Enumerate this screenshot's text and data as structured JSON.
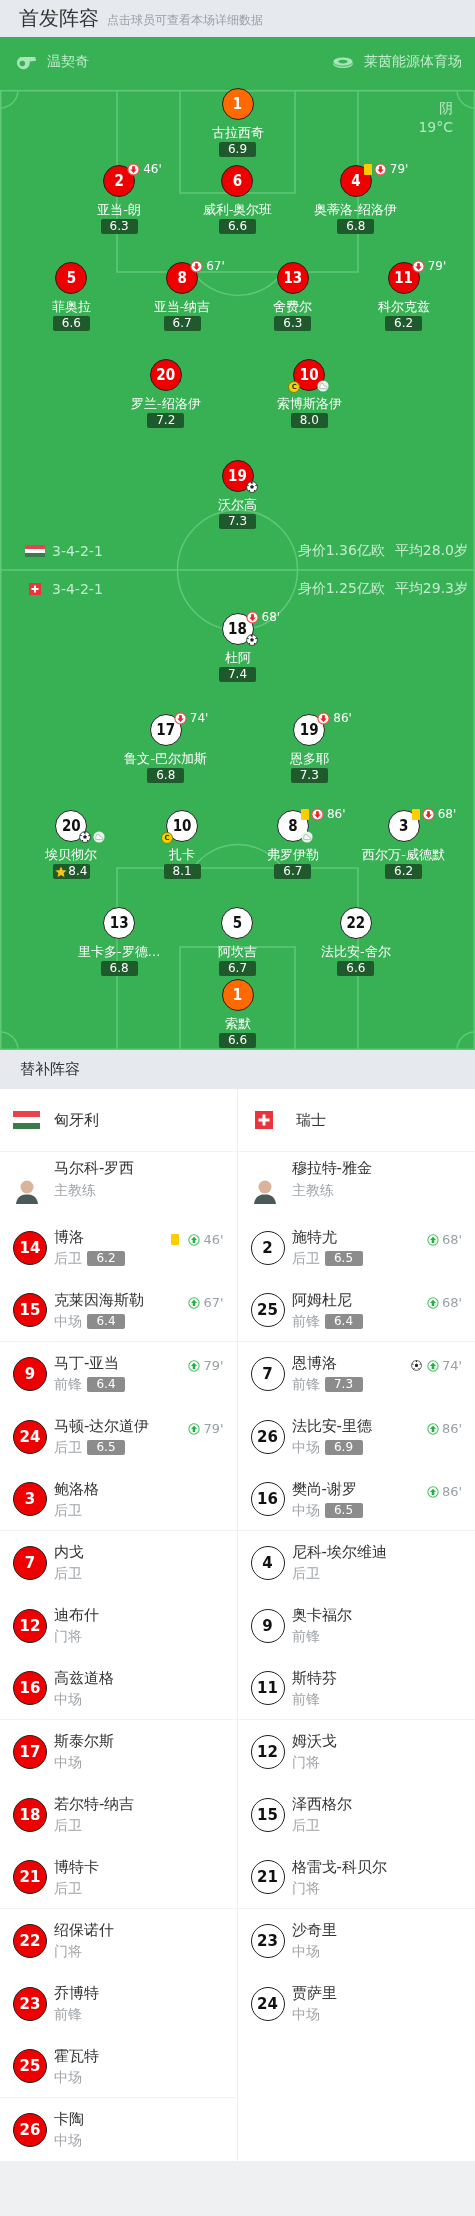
{
  "header": {
    "title": "首发阵容",
    "subtitle": "点击球员可查看本场详细数据"
  },
  "match_info": {
    "referee": "温契奇",
    "stadium": "莱茵能源体育场",
    "weather": "阴",
    "temperature": "19°C"
  },
  "lineups": [
    {
      "kind": "home",
      "formation": "3-4-2-1",
      "value": "身价1.36亿欧",
      "avg_age": "平均28.0岁",
      "lines": [
        {
          "kind": "goalkeeper",
          "players": [
            {
              "number": "1",
              "name": "古拉西奇",
              "rating": "6.9"
            }
          ]
        },
        {
          "kind": "outfield",
          "players": [
            {
              "number": "2",
              "name": "亚当-朗",
              "rating": "6.3",
              "marks": [
                {
                  "kind": "sub",
                  "text": "46'"
                }
              ]
            },
            {
              "number": "6",
              "name": "威利-奥尔班",
              "rating": "6.6"
            },
            {
              "number": "4",
              "name": "奥蒂洛-绍洛伊",
              "rating": "6.8",
              "marks": [
                {
                  "kind": "yellow"
                },
                {
                  "kind": "sub",
                  "text": "79'"
                }
              ]
            }
          ]
        },
        {
          "kind": "outfield",
          "players": [
            {
              "number": "5",
              "name": "菲奥拉",
              "rating": "6.6"
            },
            {
              "number": "8",
              "name": "亚当-纳吉",
              "rating": "6.7",
              "marks": [
                {
                  "kind": "sub",
                  "text": "67'"
                }
              ]
            },
            {
              "number": "13",
              "name": "舍费尔",
              "rating": "6.3"
            },
            {
              "number": "11",
              "name": "科尔克兹",
              "rating": "6.2",
              "marks": [
                {
                  "kind": "sub",
                  "text": "79'"
                }
              ]
            }
          ]
        },
        {
          "kind": "outfield",
          "players": [
            {
              "number": "20",
              "name": "罗兰-绍洛伊",
              "rating": "7.2"
            },
            {
              "number": "10",
              "name": "索博斯洛伊",
              "rating": "8.0",
              "marks": [
                {
                  "kind": "captain",
                  "text": "C"
                },
                {
                  "kind": "assist"
                }
              ]
            }
          ]
        },
        {
          "kind": "outfield",
          "players": [
            {
              "number": "19",
              "name": "沃尔高",
              "rating": "7.3",
              "marks": [
                {
                  "kind": "goal"
                }
              ]
            }
          ]
        }
      ]
    },
    {
      "kind": "away",
      "formation": "3-4-2-1",
      "value": "身价1.25亿欧",
      "avg_age": "平均29.3岁",
      "lines": [
        {
          "kind": "outfield",
          "players": [
            {
              "number": "18",
              "name": "杜阿",
              "rating": "7.4",
              "marks": [
                {
                  "kind": "sub",
                  "text": "68'"
                },
                {
                  "kind": "goal"
                }
              ]
            }
          ]
        },
        {
          "kind": "outfield",
          "players": [
            {
              "number": "17",
              "name": "鲁文-巴尔加斯",
              "rating": "6.8",
              "marks": [
                {
                  "kind": "sub",
                  "text": "74'"
                }
              ]
            },
            {
              "number": "19",
              "name": "恩多耶",
              "rating": "7.3",
              "marks": [
                {
                  "kind": "sub",
                  "text": "86'"
                }
              ]
            }
          ]
        },
        {
          "kind": "outfield",
          "players": [
            {
              "number": "20",
              "name": "埃贝彻尔",
              "rating": "8.4",
              "marks": [
                {
                  "kind": "goal"
                },
                {
                  "kind": "assist"
                },
                {
                  "kind": "motm"
                }
              ]
            },
            {
              "number": "10",
              "name": "扎卡",
              "rating": "8.1",
              "marks": [
                {
                  "kind": "captain",
                  "text": "C"
                }
              ]
            },
            {
              "number": "8",
              "name": "弗罗伊勒",
              "rating": "6.7",
              "marks": [
                {
                  "kind": "yellow"
                },
                {
                  "kind": "sub",
                  "text": "86'"
                },
                {
                  "kind": "assist"
                }
              ]
            },
            {
              "number": "3",
              "name": "西尔万-威德默",
              "rating": "6.2",
              "marks": [
                {
                  "kind": "yellow"
                },
                {
                  "kind": "sub",
                  "text": "68'"
                }
              ]
            }
          ]
        },
        {
          "kind": "outfield",
          "players": [
            {
              "number": "13",
              "name": "里卡多-罗德…",
              "rating": "6.8"
            },
            {
              "number": "5",
              "name": "阿坎吉",
              "rating": "6.7"
            },
            {
              "number": "22",
              "name": "法比安-舍尔",
              "rating": "6.6"
            }
          ]
        },
        {
          "kind": "goalkeeper",
          "players": [
            {
              "number": "1",
              "name": "索默",
              "rating": "6.6"
            }
          ]
        }
      ]
    }
  ],
  "bench": {
    "title": "替补阵容",
    "teams": [
      {
        "kind": "home",
        "name": "匈牙利",
        "coach": {
          "name": "马尔科-罗西",
          "role": "主教练"
        },
        "players": [
          {
            "number": "14",
            "name": "博洛",
            "position": "后卫",
            "rating": "6.2",
            "marks": [
              {
                "kind": "yellow"
              },
              {
                "kind": "sub",
                "text": "46'"
              }
            ]
          },
          {
            "number": "15",
            "name": "克莱因海斯勒",
            "position": "中场",
            "rating": "6.4",
            "marks": [
              {
                "kind": "sub",
                "text": "67'"
              }
            ]
          },
          {
            "number": "9",
            "name": "马丁-亚当",
            "position": "前锋",
            "rating": "6.4",
            "marks": [
              {
                "kind": "sub",
                "text": "79'"
              }
            ]
          },
          {
            "number": "24",
            "name": "马顿-达尔道伊",
            "position": "后卫",
            "rating": "6.5",
            "marks": [
              {
                "kind": "sub",
                "text": "79'"
              }
            ]
          },
          {
            "number": "3",
            "name": "鲍洛格",
            "position": "后卫"
          },
          {
            "number": "7",
            "name": "内戈",
            "position": "后卫"
          },
          {
            "number": "12",
            "name": "迪布什",
            "position": "门将"
          },
          {
            "number": "16",
            "name": "高兹道格",
            "position": "中场"
          },
          {
            "number": "17",
            "name": "斯泰尔斯",
            "position": "中场"
          },
          {
            "number": "18",
            "name": "若尔特-纳吉",
            "position": "后卫"
          },
          {
            "number": "21",
            "name": "博特卡",
            "position": "后卫"
          },
          {
            "number": "22",
            "name": "绍保诺什",
            "position": "门将"
          },
          {
            "number": "23",
            "name": "乔博特",
            "position": "前锋"
          },
          {
            "number": "25",
            "name": "霍瓦特",
            "position": "中场"
          },
          {
            "number": "26",
            "name": "卡陶",
            "position": "中场"
          }
        ]
      },
      {
        "kind": "away",
        "name": "瑞士",
        "coach": {
          "name": "穆拉特-雅金",
          "role": "主教练"
        },
        "players": [
          {
            "number": "2",
            "name": "施特尤",
            "position": "后卫",
            "rating": "6.5",
            "marks": [
              {
                "kind": "sub",
                "text": "68'"
              }
            ]
          },
          {
            "number": "25",
            "name": "阿姆杜尼",
            "position": "前锋",
            "rating": "6.4",
            "marks": [
              {
                "kind": "sub",
                "text": "68'"
              }
            ]
          },
          {
            "number": "7",
            "name": "恩博洛",
            "position": "前锋",
            "rating": "7.3",
            "marks": [
              {
                "kind": "goal"
              },
              {
                "kind": "sub",
                "text": "74'"
              }
            ]
          },
          {
            "number": "26",
            "name": "法比安-里德",
            "position": "中场",
            "rating": "6.9",
            "marks": [
              {
                "kind": "sub",
                "text": "86'"
              }
            ]
          },
          {
            "number": "16",
            "name": "樊尚-谢罗",
            "position": "中场",
            "rating": "6.5",
            "marks": [
              {
                "kind": "sub",
                "text": "86'"
              }
            ]
          },
          {
            "number": "4",
            "name": "尼科-埃尔维迪",
            "position": "后卫"
          },
          {
            "number": "9",
            "name": "奥卡福尔",
            "position": "前锋"
          },
          {
            "number": "11",
            "name": "斯特芬",
            "position": "前锋"
          },
          {
            "number": "12",
            "name": "姆沃戈",
            "position": "门将"
          },
          {
            "number": "15",
            "name": "泽西格尔",
            "position": "后卫"
          },
          {
            "number": "21",
            "name": "格雷戈-科贝尔",
            "position": "门将"
          },
          {
            "number": "23",
            "name": "沙奇里",
            "position": "中场"
          },
          {
            "number": "24",
            "name": "贾萨里",
            "position": "中场"
          }
        ]
      }
    ]
  }
}
